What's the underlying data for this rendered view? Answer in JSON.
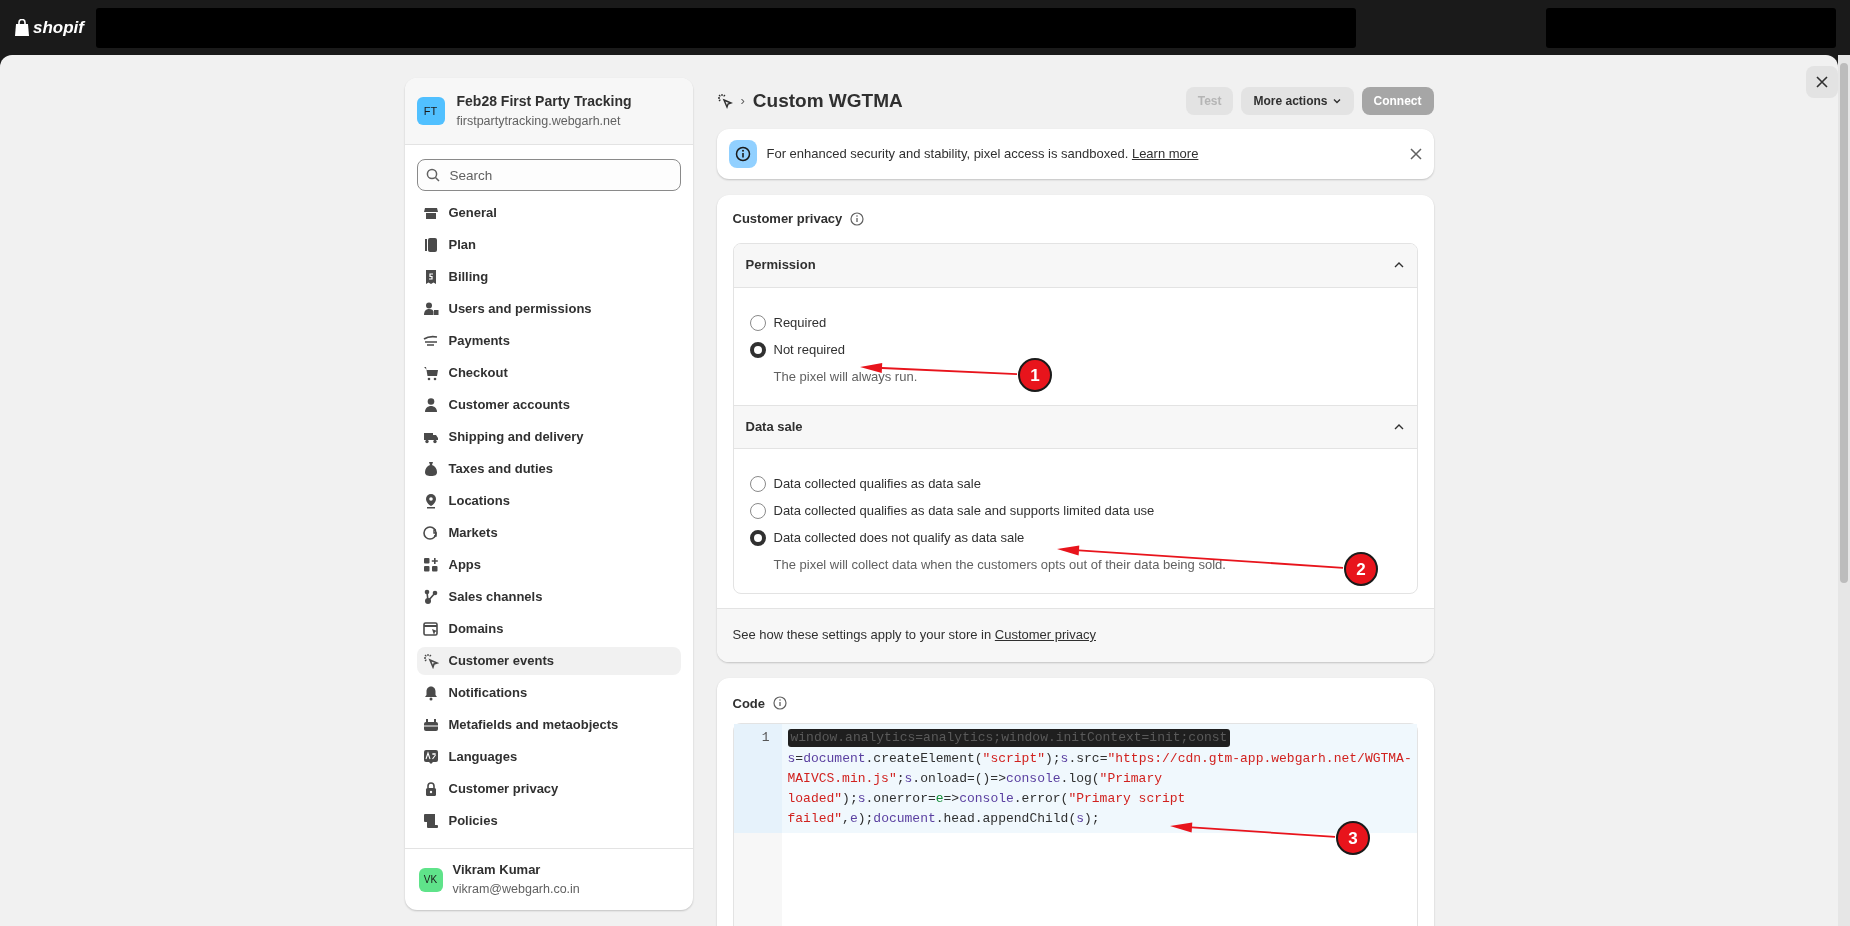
{
  "topbar": {
    "logo_text": "shopif"
  },
  "store": {
    "initials": "FT",
    "name": "Feb28 First Party Tracking",
    "domain": "firstpartytracking.webgarh.net"
  },
  "search": {
    "placeholder": "Search"
  },
  "sidebar": {
    "items": [
      {
        "label": "General",
        "selected": false
      },
      {
        "label": "Plan",
        "selected": false
      },
      {
        "label": "Billing",
        "selected": false
      },
      {
        "label": "Users and permissions",
        "selected": false
      },
      {
        "label": "Payments",
        "selected": false
      },
      {
        "label": "Checkout",
        "selected": false
      },
      {
        "label": "Customer accounts",
        "selected": false
      },
      {
        "label": "Shipping and delivery",
        "selected": false
      },
      {
        "label": "Taxes and duties",
        "selected": false
      },
      {
        "label": "Locations",
        "selected": false
      },
      {
        "label": "Markets",
        "selected": false
      },
      {
        "label": "Apps",
        "selected": false
      },
      {
        "label": "Sales channels",
        "selected": false
      },
      {
        "label": "Domains",
        "selected": false
      },
      {
        "label": "Customer events",
        "selected": true
      },
      {
        "label": "Notifications",
        "selected": false
      },
      {
        "label": "Metafields and metaobjects",
        "selected": false
      },
      {
        "label": "Languages",
        "selected": false
      },
      {
        "label": "Customer privacy",
        "selected": false
      },
      {
        "label": "Policies",
        "selected": false
      }
    ]
  },
  "user": {
    "initials": "VK",
    "name": "Vikram Kumar",
    "email": "vikram@webgarh.co.in"
  },
  "page": {
    "breadcrumb_separator": "›",
    "title": "Custom WGTMA",
    "actions": [
      {
        "label": "Test",
        "kind": "plain",
        "disabled": true
      },
      {
        "label": "More actions",
        "kind": "menu",
        "disabled": false
      },
      {
        "label": "Connect",
        "kind": "primary",
        "disabled": true
      }
    ]
  },
  "banner": {
    "text": "For enhanced security and stability, pixel access is sandboxed.",
    "link": "Learn more"
  },
  "privacy": {
    "title": "Customer privacy",
    "sections": [
      {
        "title": "Permission",
        "expanded": true,
        "options": [
          {
            "label": "Required",
            "selected": false
          },
          {
            "label": "Not required",
            "selected": true,
            "help": "The pixel will always run."
          }
        ]
      },
      {
        "title": "Data sale",
        "expanded": true,
        "options": [
          {
            "label": "Data collected qualifies as data sale",
            "selected": false
          },
          {
            "label": "Data collected qualifies as data sale and supports limited data use",
            "selected": false
          },
          {
            "label": "Data collected does not qualify as data sale",
            "selected": true,
            "help": "The pixel will collect data when the customers opts out of their data being sold."
          }
        ]
      }
    ],
    "footer_text": "See how these settings apply to your store in",
    "footer_link": "Customer privacy"
  },
  "code": {
    "title": "Code",
    "lines": [
      {
        "number": "1",
        "tokens": [
          {
            "text": "window.analytics=analytics;window.initContext=init;const",
            "kind": "redacted"
          },
          {
            "text": "s",
            "kind": "var"
          },
          {
            "text": "=",
            "kind": "plain"
          },
          {
            "text": "document",
            "kind": "var"
          },
          {
            "text": ".createElement(",
            "kind": "plain"
          },
          {
            "text": "\"script\"",
            "kind": "string"
          },
          {
            "text": ");",
            "kind": "plain"
          },
          {
            "text": "s",
            "kind": "var"
          },
          {
            "text": ".src=",
            "kind": "plain"
          },
          {
            "text": "\"https://cdn.gtm-app.webgarh.net/WGTMA-MAIVCS.min.js\"",
            "kind": "string"
          },
          {
            "text": ";",
            "kind": "plain"
          },
          {
            "text": "s",
            "kind": "var"
          },
          {
            "text": ".onload=()=>",
            "kind": "plain"
          },
          {
            "text": "console",
            "kind": "var"
          },
          {
            "text": ".log(",
            "kind": "plain"
          },
          {
            "text": "\"Primary loaded\"",
            "kind": "string"
          },
          {
            "text": ");",
            "kind": "plain"
          },
          {
            "text": "s",
            "kind": "var"
          },
          {
            "text": ".onerror=",
            "kind": "plain"
          },
          {
            "text": "e",
            "kind": "param"
          },
          {
            "text": "=>",
            "kind": "plain"
          },
          {
            "text": "console",
            "kind": "var"
          },
          {
            "text": ".error(",
            "kind": "plain"
          },
          {
            "text": "\"Primary script failed\"",
            "kind": "string"
          },
          {
            "text": ",",
            "kind": "plain"
          },
          {
            "text": "e",
            "kind": "var"
          },
          {
            "text": ");",
            "kind": "plain"
          },
          {
            "text": "document",
            "kind": "var"
          },
          {
            "text": ".head.appendChild(",
            "kind": "plain"
          },
          {
            "text": "s",
            "kind": "var"
          },
          {
            "text": ");",
            "kind": "plain"
          }
        ]
      }
    ]
  },
  "annotations": [
    {
      "number": "1"
    },
    {
      "number": "2"
    },
    {
      "number": "3"
    }
  ]
}
